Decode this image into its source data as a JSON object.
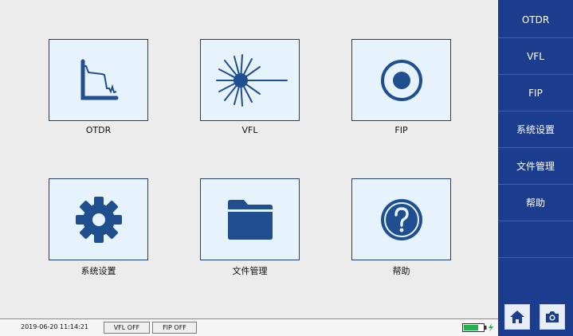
{
  "tiles": [
    {
      "label": "OTDR",
      "icon": "otdr-trace-icon"
    },
    {
      "label": "VFL",
      "icon": "laser-burst-icon"
    },
    {
      "label": "FIP",
      "icon": "record-circle-icon"
    },
    {
      "label": "系统设置",
      "icon": "gear-icon"
    },
    {
      "label": "文件管理",
      "icon": "folder-icon"
    },
    {
      "label": "帮助",
      "icon": "help-icon"
    }
  ],
  "sidebar": {
    "items": [
      {
        "label": "OTDR"
      },
      {
        "label": "VFL"
      },
      {
        "label": "FIP"
      },
      {
        "label": "系统设置"
      },
      {
        "label": "文件管理"
      },
      {
        "label": "帮助"
      }
    ],
    "home_icon": "home-icon",
    "camera_icon": "camera-icon"
  },
  "status": {
    "datetime": "2019-06-20 11:14:21",
    "vfl": "VFL OFF",
    "fip": "FIP OFF",
    "battery_icon": "battery-charging-icon",
    "battery_level": 0.75
  },
  "colors": {
    "accent": "#1c3d8d",
    "icon": "#1f4f8f",
    "tile_bg": "#e6f2fc",
    "battery_fill": "#22b14c"
  }
}
